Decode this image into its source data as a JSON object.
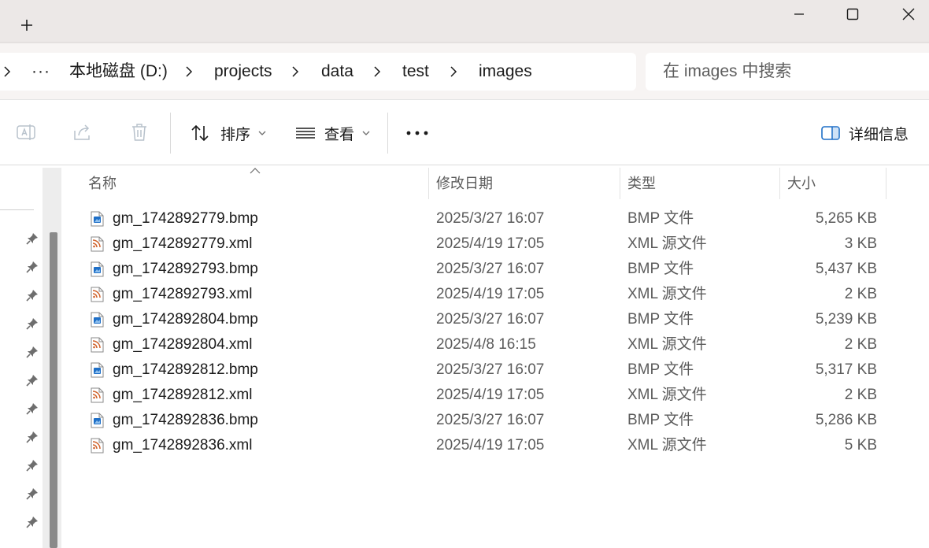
{
  "window": {
    "new_tab_label": "+"
  },
  "breadcrumb": {
    "more": "···",
    "items": [
      "本地磁盘 (D:)",
      "projects",
      "data",
      "test",
      "images"
    ]
  },
  "search": {
    "placeholder": "在 images 中搜索"
  },
  "toolbar": {
    "sort_label": "排序",
    "view_label": "查看",
    "more_label": "···",
    "details_label": "详细信息"
  },
  "columns": {
    "name": "名称",
    "modified": "修改日期",
    "type": "类型",
    "size": "大小"
  },
  "files": [
    {
      "name": "gm_1742892779.bmp",
      "modified": "2025/3/27 16:07",
      "type": "BMP 文件",
      "size": "5,265 KB",
      "icon": "bmp-file-icon"
    },
    {
      "name": "gm_1742892779.xml",
      "modified": "2025/4/19 17:05",
      "type": "XML 源文件",
      "size": "3 KB",
      "icon": "xml-file-icon"
    },
    {
      "name": "gm_1742892793.bmp",
      "modified": "2025/3/27 16:07",
      "type": "BMP 文件",
      "size": "5,437 KB",
      "icon": "bmp-file-icon"
    },
    {
      "name": "gm_1742892793.xml",
      "modified": "2025/4/19 17:05",
      "type": "XML 源文件",
      "size": "2 KB",
      "icon": "xml-file-icon"
    },
    {
      "name": "gm_1742892804.bmp",
      "modified": "2025/3/27 16:07",
      "type": "BMP 文件",
      "size": "5,239 KB",
      "icon": "bmp-file-icon"
    },
    {
      "name": "gm_1742892804.xml",
      "modified": "2025/4/8 16:15",
      "type": "XML 源文件",
      "size": "2 KB",
      "icon": "xml-file-icon"
    },
    {
      "name": "gm_1742892812.bmp",
      "modified": "2025/3/27 16:07",
      "type": "BMP 文件",
      "size": "5,317 KB",
      "icon": "bmp-file-icon"
    },
    {
      "name": "gm_1742892812.xml",
      "modified": "2025/4/19 17:05",
      "type": "XML 源文件",
      "size": "2 KB",
      "icon": "xml-file-icon"
    },
    {
      "name": "gm_1742892836.bmp",
      "modified": "2025/3/27 16:07",
      "type": "BMP 文件",
      "size": "5,286 KB",
      "icon": "bmp-file-icon"
    },
    {
      "name": "gm_1742892836.xml",
      "modified": "2025/4/19 17:05",
      "type": "XML 源文件",
      "size": "5 KB",
      "icon": "xml-file-icon"
    }
  ],
  "colors": {
    "bmp_icon": "#1e6fc7",
    "xml_icon": "#d0622b",
    "pin": "#6e6e6e"
  }
}
